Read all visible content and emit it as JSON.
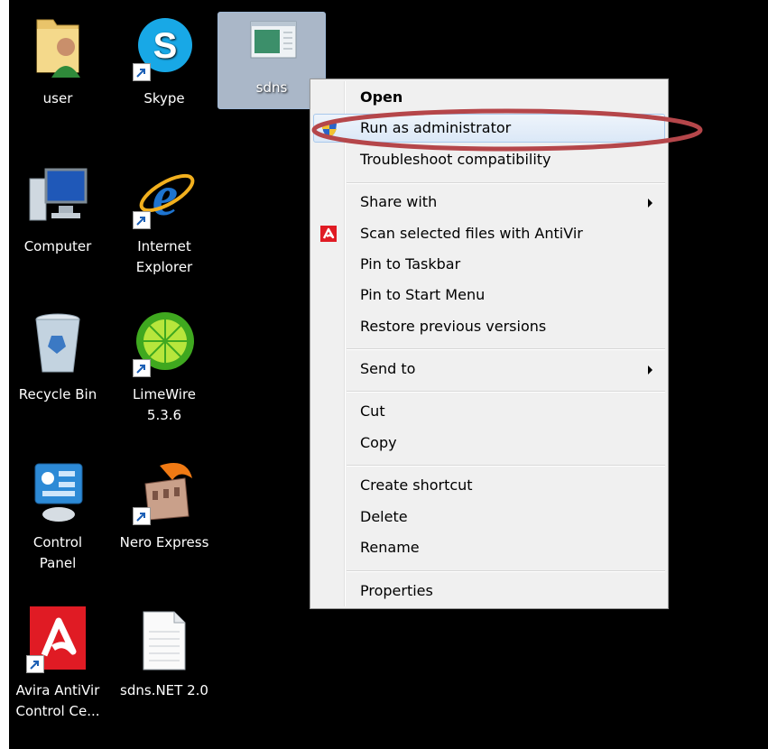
{
  "desktop_icons": [
    {
      "label": "user",
      "icon": "user-folder-icon"
    },
    {
      "label": "Skype",
      "icon": "skype-icon"
    },
    {
      "label": "sdns",
      "icon": "sdns-app-icon"
    },
    {
      "label": "Computer",
      "icon": "computer-icon"
    },
    {
      "label": "Internet\nExplorer",
      "icon": "internet-explorer-icon"
    },
    {
      "label": "Recycle Bin",
      "icon": "recycle-bin-icon"
    },
    {
      "label": "LimeWire\n5.3.6",
      "icon": "limewire-icon"
    },
    {
      "label": "Control\nPanel",
      "icon": "control-panel-icon"
    },
    {
      "label": "Nero Express",
      "icon": "nero-express-icon"
    },
    {
      "label": "Avira AntiVir\nControl Ce...",
      "icon": "avira-icon"
    },
    {
      "label": "sdns.NET 2.0",
      "icon": "text-file-icon"
    }
  ],
  "context_menu": {
    "items": [
      {
        "label": "Open",
        "bold": true
      },
      {
        "label": "Run as administrator",
        "icon": "uac-shield-icon",
        "highlighted": true
      },
      {
        "label": "Troubleshoot compatibility"
      },
      {
        "label": "Share with",
        "submenu": true
      },
      {
        "label": "Scan selected files with AntiVir",
        "icon": "avira-scan-icon"
      },
      {
        "label": "Pin to Taskbar"
      },
      {
        "label": "Pin to Start Menu"
      },
      {
        "label": "Restore previous versions"
      },
      {
        "label": "Send to",
        "submenu": true
      },
      {
        "label": "Cut"
      },
      {
        "label": "Copy"
      },
      {
        "label": "Create shortcut"
      },
      {
        "label": "Delete"
      },
      {
        "label": "Rename"
      },
      {
        "label": "Properties"
      }
    ]
  },
  "colors": {
    "desktop_bg": "#000000",
    "menu_bg": "#f0f0f0",
    "highlight_ellipse": "#b5464a"
  }
}
